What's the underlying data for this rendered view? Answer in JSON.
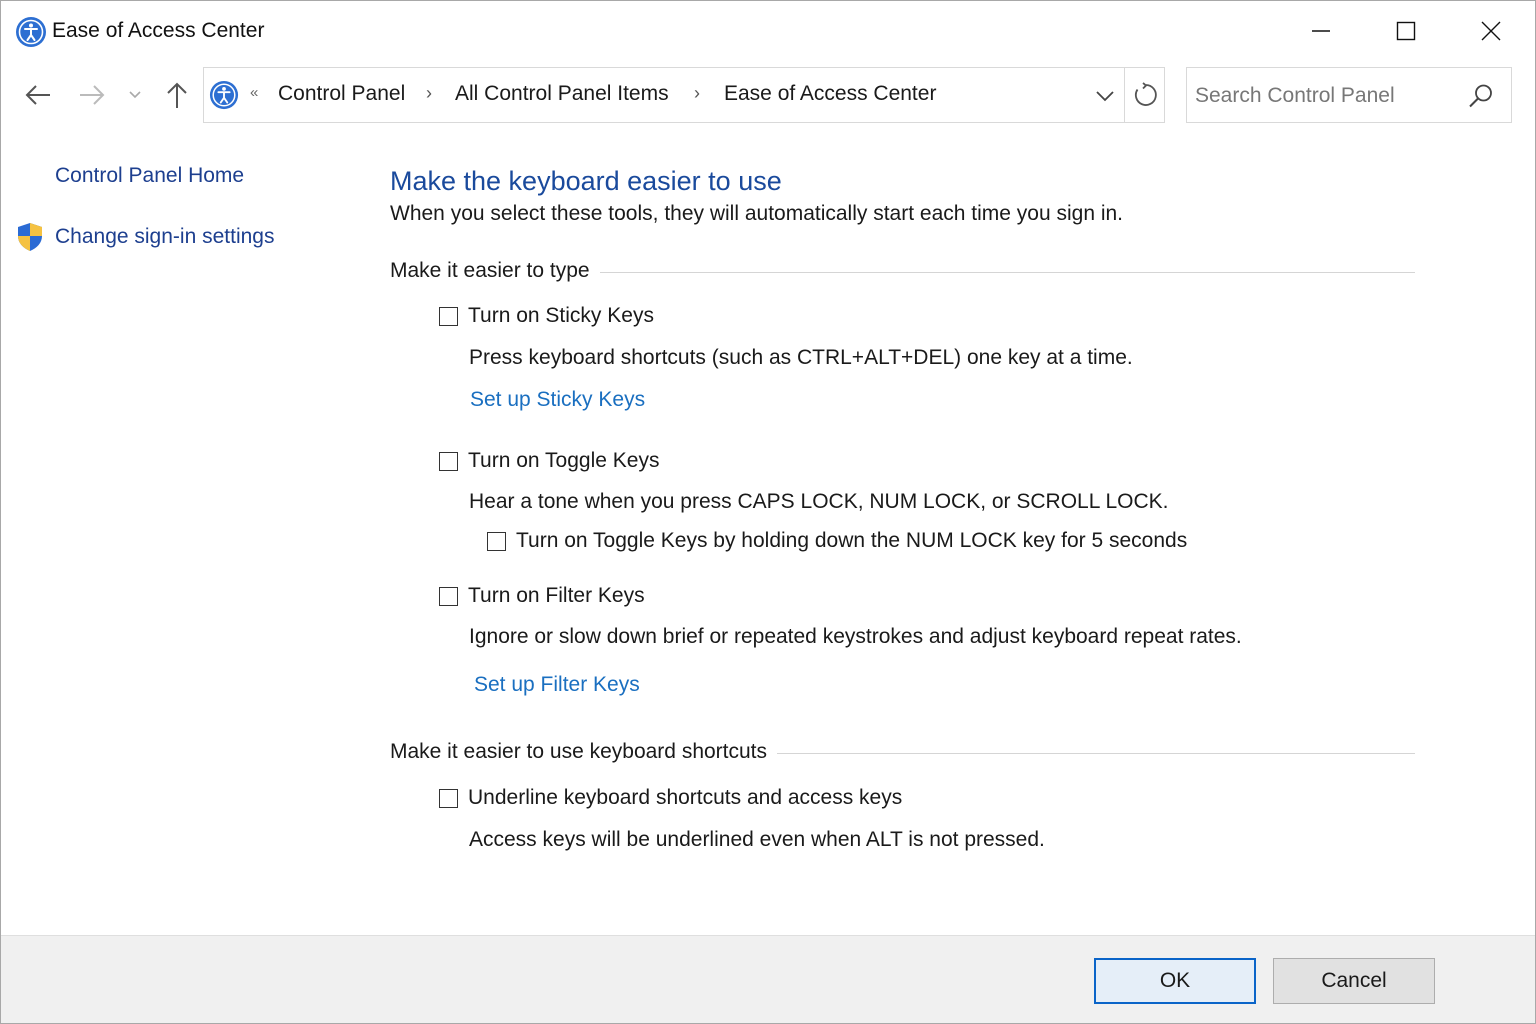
{
  "window": {
    "title": "Ease of Access Center"
  },
  "nav": {
    "breadcrumbs": [
      "Control Panel",
      "All Control Panel Items",
      "Ease of Access Center"
    ],
    "search_placeholder": "Search Control Panel"
  },
  "sidebar": {
    "items": [
      {
        "label": "Control Panel Home"
      },
      {
        "label": "Change sign-in settings",
        "icon": "shield-icon"
      }
    ]
  },
  "main": {
    "heading": "Make the keyboard easier to use",
    "subtitle": "When you select these tools, they will automatically start each time you sign in.",
    "group_type": {
      "label": "Make it easier to type",
      "sticky": {
        "checkbox_label": "Turn on Sticky Keys",
        "checked": false,
        "description": "Press keyboard shortcuts (such as CTRL+ALT+DEL) one key at a time.",
        "link": "Set up Sticky Keys"
      },
      "toggle": {
        "checkbox_label": "Turn on Toggle Keys",
        "checked": false,
        "description": "Hear a tone when you press CAPS LOCK, NUM LOCK, or SCROLL LOCK.",
        "sub_checkbox_label": "Turn on Toggle Keys by holding down the NUM LOCK key for 5 seconds",
        "sub_checked": false
      },
      "filter": {
        "checkbox_label": "Turn on Filter Keys",
        "checked": false,
        "description": "Ignore or slow down brief or repeated keystrokes and adjust keyboard repeat rates.",
        "link": "Set up Filter Keys"
      }
    },
    "group_shortcuts": {
      "label": "Make it easier to use keyboard shortcuts",
      "underline": {
        "checkbox_label": "Underline keyboard shortcuts and access keys",
        "checked": false,
        "description": "Access keys will be underlined even when ALT is not pressed."
      }
    }
  },
  "footer": {
    "ok_label": "OK",
    "cancel_label": "Cancel"
  },
  "colors": {
    "heading": "#1a4a9c",
    "link": "#1a6fc0",
    "sidebar_link": "#1d3f8f",
    "footer_bg": "#f0f0f0",
    "ok_border": "#0a64c8"
  }
}
